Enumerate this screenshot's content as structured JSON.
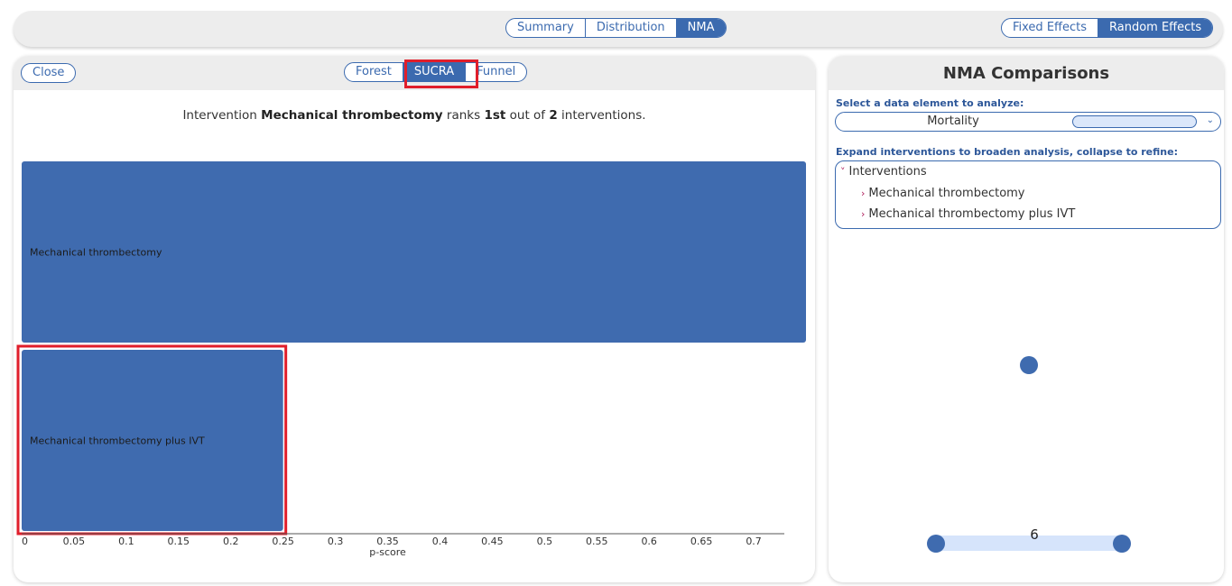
{
  "topbar": {
    "main_tabs": [
      {
        "label": "Summary",
        "active": false
      },
      {
        "label": "Distribution",
        "active": false
      },
      {
        "label": "NMA",
        "active": true
      }
    ],
    "effect_tabs": [
      {
        "label": "Fixed Effects",
        "active": false
      },
      {
        "label": "Random Effects",
        "active": true
      }
    ]
  },
  "left": {
    "close_label": "Close",
    "plot_tabs": [
      {
        "label": "Forest",
        "active": false
      },
      {
        "label": "SUCRA",
        "active": true
      },
      {
        "label": "Funnel",
        "active": false
      }
    ],
    "headline": {
      "prefix": "Intervention ",
      "intervention": "Mechanical thrombectomy",
      "middle": " ranks ",
      "rank": "1st",
      "after_rank": " out of ",
      "total": "2",
      "suffix": " interventions."
    }
  },
  "chart_data": {
    "type": "bar",
    "orientation": "horizontal",
    "categories": [
      "Mechanical thrombectomy",
      "Mechanical thrombectomy plus IVT"
    ],
    "values": [
      0.75,
      0.25
    ],
    "xlabel": "p-score",
    "xlim": [
      0,
      0.75
    ],
    "xticks": [
      "0",
      "0.05",
      "0.1",
      "0.15",
      "0.2",
      "0.25",
      "0.3",
      "0.35",
      "0.4",
      "0.45",
      "0.5",
      "0.55",
      "0.6",
      "0.65",
      "0.7"
    ],
    "bar_color": "#3f6baf",
    "highlight_color": "#e01e2b"
  },
  "right": {
    "title": "NMA Comparisons",
    "select_label": "Select a data element to analyze:",
    "select_value": "Mortality",
    "expand_label": "Expand interventions to broaden analysis, collapse to refine:",
    "tree_root": "Interventions",
    "tree_items": [
      "Mechanical thrombectomy",
      "Mechanical thrombectomy plus IVT"
    ],
    "network": {
      "edge_label": "6",
      "node_color": "#3f6baf",
      "edge_color": "#d6e4fb"
    }
  }
}
